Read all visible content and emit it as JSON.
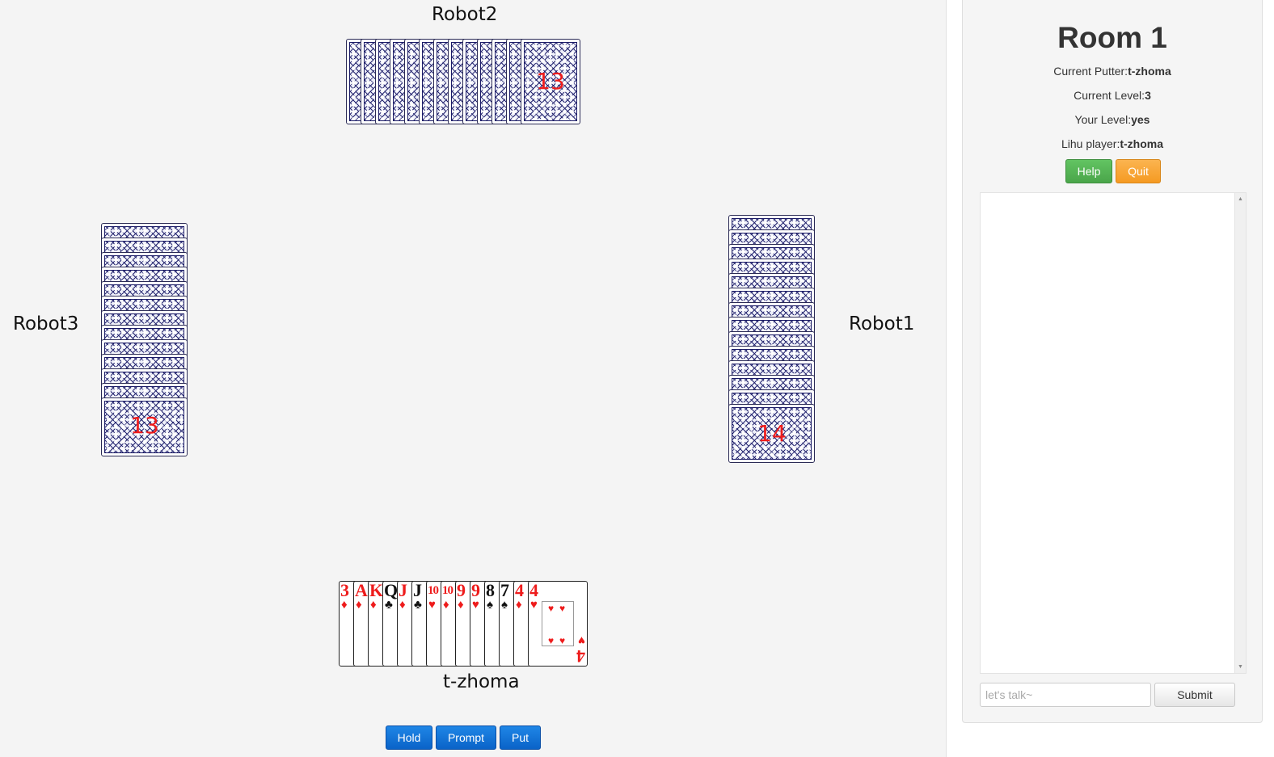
{
  "table": {
    "players": {
      "top": {
        "name": "Robot2",
        "card_count": "13"
      },
      "left": {
        "name": "Robot3",
        "card_count": "13"
      },
      "right": {
        "name": "Robot1",
        "card_count": "14"
      },
      "bottom": {
        "name": "t-zhoma"
      }
    },
    "hand": [
      {
        "rank": "3",
        "suit": "diamond-icon",
        "color": "red"
      },
      {
        "rank": "A",
        "suit": "diamond-icon",
        "color": "red"
      },
      {
        "rank": "K",
        "suit": "diamond-icon",
        "color": "red"
      },
      {
        "rank": "Q",
        "suit": "club-icon",
        "color": "black"
      },
      {
        "rank": "J",
        "suit": "diamond-icon",
        "color": "red"
      },
      {
        "rank": "J",
        "suit": "club-icon",
        "color": "black"
      },
      {
        "rank": "10",
        "suit": "heart-icon",
        "color": "red"
      },
      {
        "rank": "10",
        "suit": "diamond-icon",
        "color": "red"
      },
      {
        "rank": "9",
        "suit": "diamond-icon",
        "color": "red"
      },
      {
        "rank": "9",
        "suit": "heart-icon",
        "color": "red"
      },
      {
        "rank": "8",
        "suit": "spade-icon",
        "color": "black"
      },
      {
        "rank": "7",
        "suit": "spade-icon",
        "color": "black"
      },
      {
        "rank": "4",
        "suit": "diamond-icon",
        "color": "red"
      },
      {
        "rank": "4",
        "suit": "heart-icon",
        "color": "red"
      }
    ],
    "actions": {
      "hold": "Hold",
      "prompt": "Prompt",
      "put": "Put"
    }
  },
  "panel": {
    "title": "Room 1",
    "info": [
      {
        "label": "Current Putter:",
        "value": "t-zhoma"
      },
      {
        "label": "Current Level:",
        "value": "3"
      },
      {
        "label": "Your Level:",
        "value": "yes"
      },
      {
        "label": "Lihu player:",
        "value": "t-zhoma"
      }
    ],
    "help_label": "Help",
    "quit_label": "Quit",
    "chat": {
      "placeholder": "let's talk~",
      "value": "",
      "submit_label": "Submit"
    }
  },
  "colors": {
    "table_bg": "#f4f4f4",
    "card_back": "#24246e",
    "count_red": "#ee1c1c",
    "btn_blue": "#0a63c8",
    "btn_green": "#5cb85c",
    "btn_orange": "#f0ad4e"
  }
}
